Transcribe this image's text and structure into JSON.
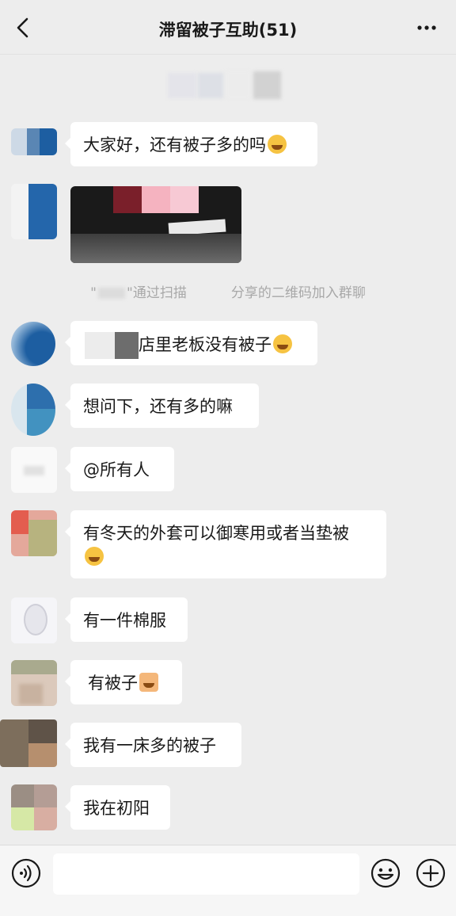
{
  "header": {
    "title": "滞留被子互助(51)",
    "back_icon": "chevron-left-icon",
    "more_icon": "more-horizontal-icon"
  },
  "messages": [
    {
      "text": "大家好，还有被子多的吗",
      "emoji": "rofl-emoji"
    },
    {
      "type": "image"
    },
    {
      "text": "店里老板没有被子",
      "emoji": "rofl-emoji"
    },
    {
      "text": "想问下，还有多的嘛"
    },
    {
      "text": "@所有人"
    },
    {
      "text": "有冬天的外套可以御寒用或者当垫被",
      "emoji": "thinking-emoji"
    },
    {
      "text": "有一件棉服"
    },
    {
      "text": "有被子",
      "emoji": "raising-hand-emoji"
    },
    {
      "text": "我有一床多的被子"
    },
    {
      "text": "我在初阳"
    }
  ],
  "system": {
    "open_quote": "\"",
    "close_quote": "\"通过扫描",
    "suffix": "分享的二维码加入群聊"
  },
  "input_bar": {
    "placeholder": "",
    "voice_icon": "voice-icon",
    "emoji_icon": "emoji-icon",
    "plus_icon": "plus-icon"
  },
  "colors": {
    "background": "#ededed",
    "bubble": "#ffffff",
    "text": "#191919",
    "system_text": "#a8a8a8"
  }
}
